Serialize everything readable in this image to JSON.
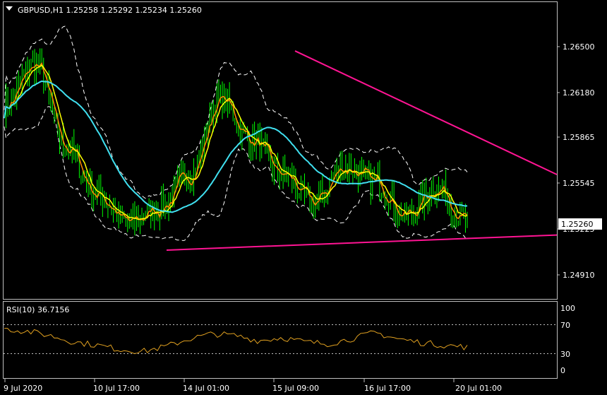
{
  "window": {
    "symbol_header": "GBPUSD,H1  1.25258 1.25292 1.25234 1.25260",
    "dropdown_icon": "triangle-down-icon"
  },
  "price_axis": {
    "labels": [
      "1.26500",
      "1.26180",
      "1.25865",
      "1.25545",
      "1.25225",
      "1.24910"
    ],
    "current_price": "1.25260"
  },
  "time_axis": {
    "labels": [
      "9 Jul 2020",
      "10 Jul 17:00",
      "14 Jul 01:00",
      "15 Jul 09:00",
      "16 Jul 17:00",
      "20 Jul 01:00"
    ]
  },
  "rsi_panel": {
    "title": "RSI(10) 36.7156",
    "levels": [
      "100",
      "70",
      "30",
      "0"
    ]
  },
  "colors": {
    "background": "#000000",
    "grid_frame": "#c0c0c0",
    "candles": "#00ff00",
    "ma_fast": "#ff8c00",
    "ma_mid": "#ffff00",
    "ma_slow": "#40e0f0",
    "bands": "#ffffff",
    "trendline": "#ff1493",
    "rsi": "#e0a020",
    "price_tag_bg": "#ffffff",
    "price_tag_text": "#000000"
  },
  "chart_data": {
    "type": "line",
    "title": "GBPUSD,H1  1.25258 1.25292 1.25234 1.25260",
    "xlabel": "",
    "ylabel": "",
    "ylim": [
      1.247,
      1.2685
    ],
    "x": [
      "9 Jul 2020",
      "10 Jul 17:00",
      "14 Jul 01:00",
      "15 Jul 09:00",
      "16 Jul 17:00",
      "20 Jul 01:00"
    ],
    "series": [
      {
        "name": "",
        "values": [
          1.261,
          1.264,
          1.258,
          1.2545,
          1.2525,
          1.2535,
          1.256,
          1.2615,
          1.2585,
          1.256,
          1.254,
          1.2565,
          1.2555,
          1.253,
          1.255,
          1.2526
        ]
      }
    ],
    "trendlines": [
      {
        "from": [
          1.265
        ],
        "to": [
          1.256
        ]
      },
      {
        "from": [
          1.2505
        ],
        "to": [
          1.2516
        ]
      }
    ],
    "rsi": {
      "ylim": [
        0,
        100
      ],
      "levels": [
        30,
        70
      ],
      "values": [
        66,
        62,
        55,
        45,
        40,
        33,
        30,
        38,
        50,
        58,
        55,
        47,
        52,
        45,
        42,
        50,
        60,
        50,
        44,
        40,
        36.7
      ]
    }
  }
}
